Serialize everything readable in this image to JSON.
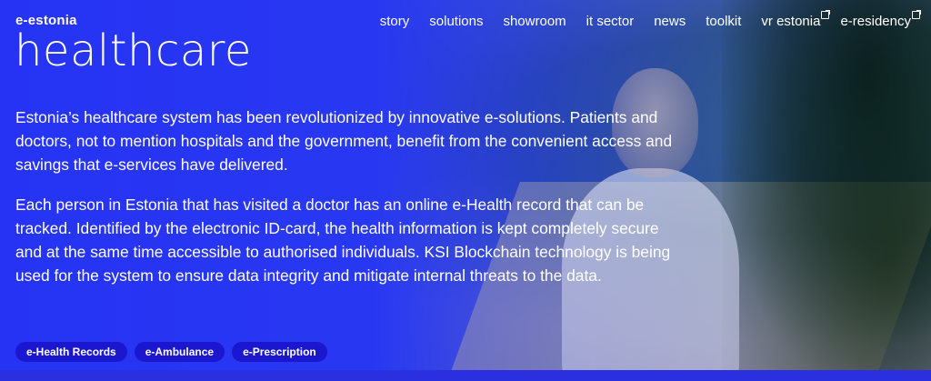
{
  "header": {
    "logo": "e-estonia",
    "nav": [
      {
        "label": "story",
        "external": false
      },
      {
        "label": "solutions",
        "external": false
      },
      {
        "label": "showroom",
        "external": false
      },
      {
        "label": "it sector",
        "external": false
      },
      {
        "label": "news",
        "external": false
      },
      {
        "label": "toolkit",
        "external": false
      },
      {
        "label": "vr estonia",
        "external": true
      },
      {
        "label": "e-residency",
        "external": true
      }
    ]
  },
  "page": {
    "title": "healthcare",
    "paragraphs": [
      "Estonia’s healthcare system has been revolutionized by innovative e-solutions. Patients and doctors, not to mention hospitals and the government, benefit from the convenient access and savings that e-services have delivered.",
      "Each person in Estonia that has visited a doctor has an online e-Health record that can be tracked. Identified by the electronic ID-card, the health information is kept completely secure and at the same time accessible to authorised individuals. KSI Blockchain technology is being used for the system to ensure data integrity and mitigate internal threats to the data."
    ],
    "tags": [
      "e-Health Records",
      "e-Ambulance",
      "e-Prescription"
    ]
  },
  "colors": {
    "overlay": "#2633f4",
    "tag_bg": "#1a17cf",
    "text": "#ffffff"
  }
}
